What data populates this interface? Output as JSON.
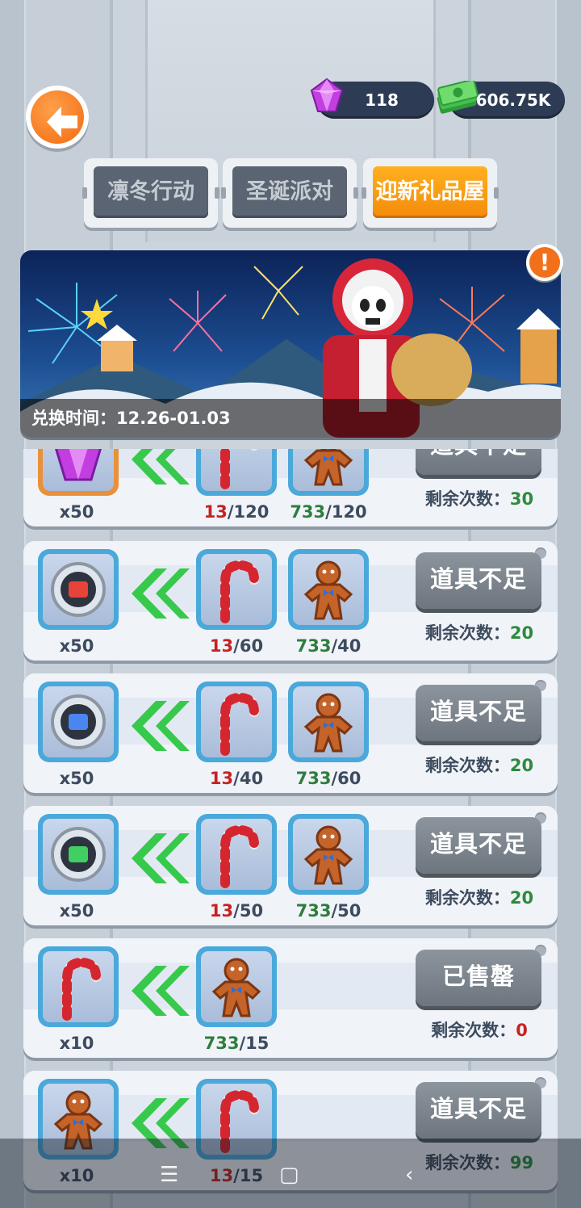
{
  "currency": {
    "gems": "118",
    "cash": "606.75K"
  },
  "tabs": [
    {
      "label": "凛冬行动",
      "active": false
    },
    {
      "label": "圣诞派对",
      "active": false
    },
    {
      "label": "迎新礼品屋",
      "active": true
    }
  ],
  "banner": {
    "caption": "兑换时间：12.26-01.03"
  },
  "rows": [
    {
      "reward": "gem",
      "reward_count": "x50",
      "costs": [
        {
          "item": "candy-cane",
          "have": "13",
          "need": "/120",
          "enough": false
        },
        {
          "item": "gingerbread",
          "have": "733",
          "need": "/120",
          "enough": true
        }
      ],
      "button": "道具不足",
      "remaining_label": "剩余次数：",
      "remaining": "30",
      "remaining_ok": true
    },
    {
      "reward": "red-fist-coin",
      "reward_count": "x50",
      "costs": [
        {
          "item": "candy-cane",
          "have": "13",
          "need": "/60",
          "enough": false
        },
        {
          "item": "gingerbread",
          "have": "733",
          "need": "/40",
          "enough": true
        }
      ],
      "button": "道具不足",
      "remaining_label": "剩余次数：",
      "remaining": "20",
      "remaining_ok": true
    },
    {
      "reward": "blue-fist-coin",
      "reward_count": "x50",
      "costs": [
        {
          "item": "candy-cane",
          "have": "13",
          "need": "/40",
          "enough": false
        },
        {
          "item": "gingerbread",
          "have": "733",
          "need": "/60",
          "enough": true
        }
      ],
      "button": "道具不足",
      "remaining_label": "剩余次数：",
      "remaining": "20",
      "remaining_ok": true
    },
    {
      "reward": "green-fist-coin",
      "reward_count": "x50",
      "costs": [
        {
          "item": "candy-cane",
          "have": "13",
          "need": "/50",
          "enough": false
        },
        {
          "item": "gingerbread",
          "have": "733",
          "need": "/50",
          "enough": true
        }
      ],
      "button": "道具不足",
      "remaining_label": "剩余次数：",
      "remaining": "20",
      "remaining_ok": true
    },
    {
      "reward": "candy-cane",
      "reward_count": "x10",
      "costs": [
        {
          "item": "gingerbread",
          "have": "733",
          "need": "/15",
          "enough": true
        }
      ],
      "button": "已售罄",
      "remaining_label": "剩余次数：",
      "remaining": "0",
      "remaining_ok": false
    },
    {
      "reward": "gingerbread",
      "reward_count": "x10",
      "costs": [
        {
          "item": "candy-cane",
          "have": "13",
          "need": "/15",
          "enough": false
        }
      ],
      "button": "道具不足",
      "remaining_label": "剩余次数：",
      "remaining": "99",
      "remaining_ok": true
    }
  ],
  "navbar": {
    "menu": "☰",
    "home": "▢",
    "back": "‹"
  },
  "colors": {
    "accent": "#f48b0a",
    "slot_border": "#4aa8da",
    "enough": "#2e7d3d",
    "not_enough": "#c62222"
  }
}
